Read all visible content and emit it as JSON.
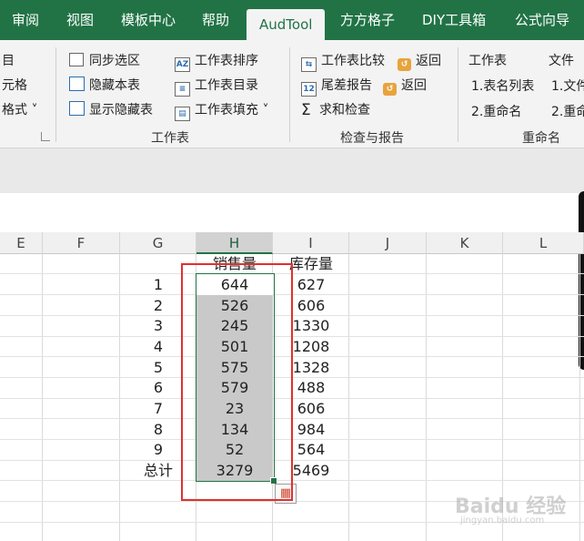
{
  "tabs": [
    "审阅",
    "视图",
    "模板中心",
    "帮助",
    "AudTool",
    "方方格子",
    "DIY工具箱",
    "公式向导"
  ],
  "active_tab": "AudTool",
  "ribbon": {
    "left_partial": [
      "目",
      "元格",
      "格式 ˅"
    ],
    "sheet_items": [
      "同步选区",
      "隐藏本表",
      "显示隐藏表"
    ],
    "sheet_items2": [
      "工作表排序",
      "工作表目录",
      "工作表填充 ˅"
    ],
    "sheet_group_label": "工作表",
    "check_items": [
      "工作表比较",
      "尾差报告",
      "求和检查"
    ],
    "return_label": "返回",
    "check_group_label": "检查与报告",
    "rename_headers": [
      "工作表",
      "文件"
    ],
    "rename_items": [
      "1.表名列表",
      "1.文件",
      "2.重命名",
      "2.重命"
    ],
    "rename_group_label": "重命名"
  },
  "columns": [
    "E",
    "F",
    "G",
    "H",
    "I",
    "J",
    "K",
    "L"
  ],
  "header_row": {
    "h": "销售量",
    "i": "库存量"
  },
  "rows": [
    {
      "g": "1",
      "h": "644",
      "i": "627"
    },
    {
      "g": "2",
      "h": "526",
      "i": "606"
    },
    {
      "g": "3",
      "h": "245",
      "i": "1330"
    },
    {
      "g": "4",
      "h": "501",
      "i": "1208"
    },
    {
      "g": "5",
      "h": "575",
      "i": "1328"
    },
    {
      "g": "6",
      "h": "579",
      "i": "488"
    },
    {
      "g": "7",
      "h": "23",
      "i": "606"
    },
    {
      "g": "8",
      "h": "134",
      "i": "984"
    },
    {
      "g": "9",
      "h": "52",
      "i": "564"
    }
  ],
  "total_row": {
    "g": "总计",
    "h": "3279",
    "i": "5469"
  },
  "watermark": {
    "main": "Baidu 经验",
    "sub": "jingyan.baidu.com"
  },
  "colors": {
    "accent": "#217346",
    "annotation": "#e03030"
  }
}
